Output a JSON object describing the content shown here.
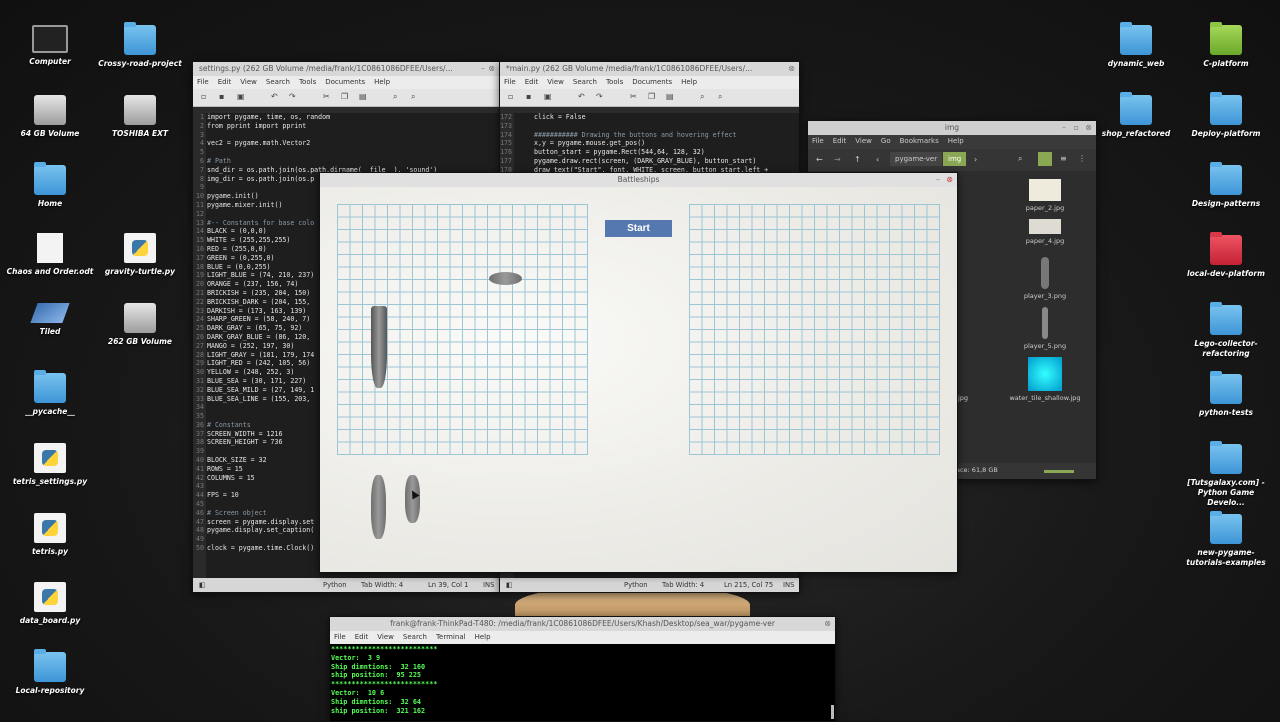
{
  "desktop": {
    "left_icons": [
      {
        "label": "Computer",
        "icon": "computer-icon"
      },
      {
        "label": "Crossy-road-project",
        "icon": "folder-icon"
      },
      {
        "label": "64 GB Volume",
        "icon": "drive-icon"
      },
      {
        "label": "TOSHIBA EXT",
        "icon": "drive-icon"
      },
      {
        "label": "Home",
        "icon": "home-folder-icon"
      },
      {
        "label": "Chaos and Order.odt",
        "icon": "document-icon"
      },
      {
        "label": "gravity-turtle.py",
        "icon": "python-file-icon"
      },
      {
        "label": "Tiled",
        "icon": "tiled-icon"
      },
      {
        "label": "262 GB Volume",
        "icon": "drive-icon"
      },
      {
        "label": "__pycache__",
        "icon": "folder-icon"
      },
      {
        "label": "tetris_settings.py",
        "icon": "python-file-icon"
      },
      {
        "label": "tetris.py",
        "icon": "python-file-icon"
      },
      {
        "label": "data_board.py",
        "icon": "python-file-icon"
      },
      {
        "label": "Local-repository",
        "icon": "folder-icon"
      }
    ],
    "right_icons": [
      {
        "label": "dynamic_web",
        "icon": "folder-icon"
      },
      {
        "label": "C-platform",
        "icon": "folder-icon"
      },
      {
        "label": "shop_refactored",
        "icon": "folder-icon"
      },
      {
        "label": "Deploy-platform",
        "icon": "folder-icon"
      },
      {
        "label": "Design-patterns",
        "icon": "folder-icon"
      },
      {
        "label": "local-dev-platform",
        "icon": "folder-icon"
      },
      {
        "label": "Lego-collector-refactoring",
        "icon": "folder-icon"
      },
      {
        "label": "python-tests",
        "icon": "folder-icon"
      },
      {
        "label": "[Tutsgalaxy.com] - Python Game Develo...",
        "icon": "folder-icon"
      },
      {
        "label": "new-pygame-tutorials-examples",
        "icon": "folder-icon"
      }
    ]
  },
  "editor_left": {
    "title": "settings.py (262 GB Volume /media/frank/1C0861086DFEE/Users/...",
    "menu": [
      "File",
      "Edit",
      "View",
      "Search",
      "Tools",
      "Documents",
      "Help"
    ],
    "line_numbers": [
      "1",
      "2",
      "3",
      "4",
      "5",
      "6",
      "7",
      "8",
      "9",
      "10",
      "11",
      "12",
      "13",
      "14",
      "15",
      "16",
      "17",
      "18",
      "19",
      "20",
      "21",
      "22",
      "23",
      "24",
      "25",
      "26",
      "27",
      "28",
      "29",
      "30",
      "31",
      "32",
      "33",
      "34",
      "35",
      "36",
      "37",
      "38",
      "39",
      "40",
      "41",
      "42",
      "43",
      "44",
      "45",
      "46",
      "47",
      "48",
      "49",
      "50"
    ],
    "lines": [
      "import pygame, time, os, random",
      "from pprint import pprint",
      "",
      "vec2 = pygame.math.Vector2",
      "",
      "# Path",
      "snd_dir = os.path.join(os.path.dirname(__file__), 'sound')",
      "img_dir = os.path.join(os.p",
      "",
      "pygame.init()",
      "pygame.mixer.init()",
      "",
      "#-- Constants for base colo",
      "BLACK = (0,0,0)",
      "WHITE = (255,255,255)",
      "RED = (255,0,0)",
      "GREEN = (0,255,0)",
      "BLUE = (0,0,255)",
      "LIGHT_BLUE = (74, 210, 237)",
      "ORANGE = (237, 156, 74)",
      "BRICKISH = (235, 204, 150)",
      "BRICKISH_DARK = (204, 155,",
      "DARKISH = (173, 163, 139)",
      "SHARP_GREEN = (58, 240, 7)",
      "DARK_GRAY = (65, 75, 92)",
      "DARK_GRAY_BLUE = (86, 120,",
      "MANGO = (252, 197, 30)",
      "LIGHT_GRAY = (181, 179, 174",
      "LIGHT_RED = (242, 105, 56)",
      "YELLOW = (248, 252, 3)",
      "BLUE_SEA = (30, 171, 227)",
      "BLUE_SEA_MILD = (27, 149, 1",
      "BLUE_SEA_LINE = (155, 203,",
      "",
      "",
      "# Constants",
      "SCREEN_WIDTH = 1216",
      "SCREEN_HEIGHT = 736",
      "",
      "BLOCK_SIZE = 32",
      "ROWS = 15",
      "COLUMNS = 15",
      "",
      "FPS = 10",
      "",
      "# Screen object",
      "screen = pygame.display.set",
      "pygame.display.set_caption(",
      "",
      "clock = pygame.time.Clock()"
    ],
    "status": {
      "lang": "Python",
      "tab": "Tab Width: 4",
      "pos": "Ln 39, Col 1",
      "mode": "INS"
    }
  },
  "editor_right": {
    "title": "*main.py (262 GB Volume /media/frank/1C0861086DFEE/Users/...",
    "menu": [
      "File",
      "Edit",
      "View",
      "Search",
      "Tools",
      "Documents",
      "Help"
    ],
    "line_numbers": [
      "172",
      "173",
      "174",
      "175",
      "176",
      "177",
      "178"
    ],
    "lines": [
      "click = False",
      "",
      "########### Drawing the buttons and hovering effect",
      "x,y = pygame.mouse.get_pos()",
      "button_start = pygame.Rect(544,64, 128, 32)",
      "pygame.draw.rect(screen, (DARK_GRAY_BLUE), button_start)",
      "draw_text(\"Start\", font, WHITE, screen, button_start.left +"
    ],
    "status": {
      "lang": "Python",
      "tab": "Tab Width: 4",
      "pos": "Ln 215, Col 75",
      "mode": "INS"
    }
  },
  "file_manager": {
    "title": "img",
    "menu": [
      "File",
      "Edit",
      "View",
      "Go",
      "Bookmarks",
      "Help"
    ],
    "path": [
      "pygame-ver",
      "img"
    ],
    "files": [
      {
        "name": "paper_2.jpg"
      },
      {
        "name": "paper_4.jpg"
      },
      {
        "name": "player_3.png"
      },
      {
        "name": "player_5.png"
      },
      {
        "name": "water_tile_shallow.jpg"
      }
    ],
    "partial_file": "jpg",
    "free_space": "ace: 61,8 GB"
  },
  "game": {
    "title": "Battleships",
    "start_button": "Start",
    "button_color": "#5678b0"
  },
  "terminal": {
    "title": "frank@frank-ThinkPad-T480: /media/frank/1C0861086DFEE/Users/Khash/Desktop/sea_war/pygame-ver",
    "menu": [
      "File",
      "Edit",
      "View",
      "Search",
      "Terminal",
      "Help"
    ],
    "lines": [
      "**************************",
      "Vector:  3 9",
      "Ship dimntions:  32 160",
      "ship position:  95 225",
      "**************************",
      "Vector:  10 6",
      "Ship dimntions:  32 64",
      "ship position:  321 162"
    ]
  }
}
